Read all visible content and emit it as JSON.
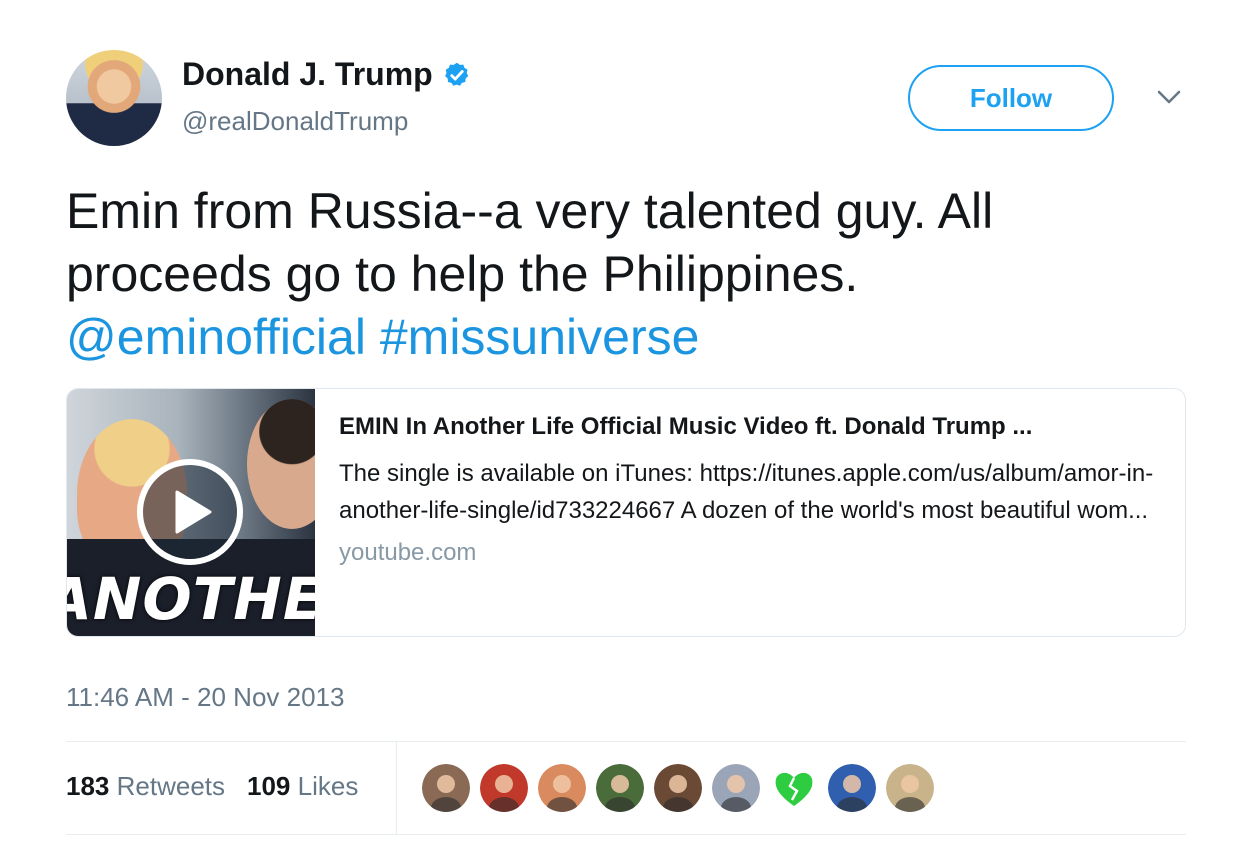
{
  "author": {
    "name": "Donald J. Trump",
    "handle": "@realDonaldTrump",
    "verified": true
  },
  "follow_label": "Follow",
  "tweet": {
    "text": "Emin from Russia--a very talented guy. All proceeds go to help the Philippines.",
    "mention": "@eminofficial",
    "hashtag": "#missuniverse"
  },
  "card": {
    "thumbnail_text": "ANOTHER LI",
    "title": "EMIN In Another Life Official Music Video ft. Donald Trump ...",
    "description": "The single is available on iTunes: https://itunes.apple.com/us/album/amor-in-another-life-single/id733224667 A dozen of the world's most beautiful wom...",
    "domain": "youtube.com"
  },
  "timestamp": "11:46 AM - 20 Nov 2013",
  "stats": {
    "retweets_count": "183",
    "retweets_label": "Retweets",
    "likes_count": "109",
    "likes_label": "Likes"
  },
  "likers": [
    {
      "icon": "liker-avatar",
      "color": "#8a6a55"
    },
    {
      "icon": "liker-avatar",
      "color": "#c0392b"
    },
    {
      "icon": "liker-avatar",
      "color": "#d98a5e"
    },
    {
      "icon": "liker-avatar",
      "color": "#4a6b3a"
    },
    {
      "icon": "liker-avatar",
      "color": "#6b4a35"
    },
    {
      "icon": "liker-avatar",
      "color": "#9aa6b8"
    },
    {
      "icon": "broken-heart-icon",
      "color": "#2ecc40"
    },
    {
      "icon": "liker-avatar",
      "color": "#2f5fae"
    },
    {
      "icon": "liker-avatar",
      "color": "#c9b38a"
    }
  ],
  "colors": {
    "accent": "#1da1f2",
    "link": "#1b95e0",
    "secondary_text": "#657786"
  }
}
